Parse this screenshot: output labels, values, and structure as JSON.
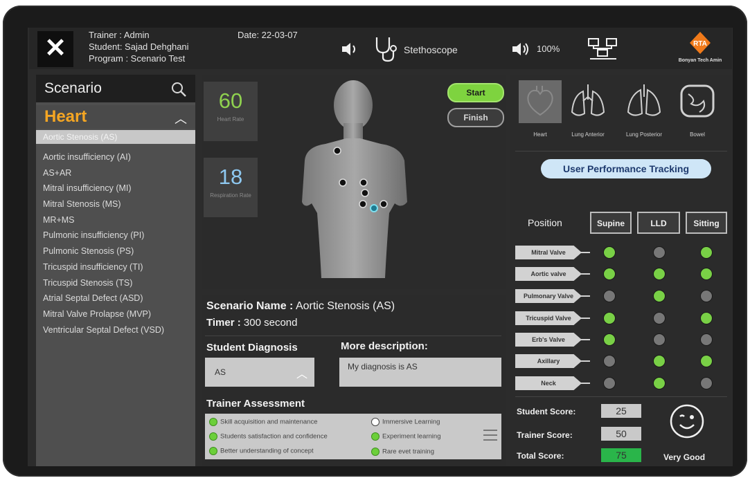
{
  "header": {
    "trainer": "Trainer : Admin",
    "student": "Student: Sajad Dehghani",
    "program": "Program : Scenario Test",
    "date": "Date: 22-03-07",
    "device_label": "Stethoscope",
    "volume": "100%",
    "logo_text": "Bonyan Tech Amin"
  },
  "sidebar": {
    "search_placeholder": "Scenario",
    "category": "Heart",
    "selected_item": "Aortic Stenosis (AS)",
    "items": [
      "Aortic insufficiency (AI)",
      "AS+AR",
      "Mitral insufficiency (MI)",
      "Mitral Stenosis (MS)",
      "MR+MS",
      "Pulmonic insufficiency (PI)",
      "Pulmonic Stenosis (PS)",
      "Tricuspid insufficiency (TI)",
      "Tricuspid Stenosis (TS)",
      "Atrial Septal Defect (ASD)",
      "Mitral Valve Prolapse (MVP)",
      "Ventricular Septal Defect (VSD)"
    ]
  },
  "vitals": {
    "heart_rate": "60",
    "heart_rate_label": "Heart Rate",
    "resp_rate": "18",
    "resp_rate_label": "Respiration Rate",
    "start_label": "Start",
    "finish_label": "Finish"
  },
  "scenario": {
    "name_label": "Scenario Name :",
    "name_value": "Aortic Stenosis (AS)",
    "timer_label": "Timer :",
    "timer_value": "300 second",
    "diagnosis_label": "Student Diagnosis",
    "diagnosis_value": "AS",
    "desc_label": "More description:",
    "desc_value": "My diagnosis is AS",
    "assessment_label": "Trainer Assessment",
    "assessment": [
      {
        "label": "Skill acquisition and maintenance",
        "checked": true
      },
      {
        "label": "Students satisfaction and confidence",
        "checked": true
      },
      {
        "label": "Better understanding of concept",
        "checked": true
      },
      {
        "label": "Immersive Learning",
        "checked": false
      },
      {
        "label": "Experiment learning",
        "checked": true
      },
      {
        "label": "Rare evet training",
        "checked": true
      }
    ]
  },
  "organs": [
    "Heart",
    "Lung Anterior",
    "Lung Posterior",
    "Bowel"
  ],
  "tracking": {
    "button_label": "User Performance Tracking",
    "position_label": "Position",
    "positions": [
      "Supine",
      "LLD",
      "Sitting"
    ],
    "valves": [
      {
        "name": "Mitral Valve",
        "states": [
          "g",
          "gr",
          "g"
        ]
      },
      {
        "name": "Aortic valve",
        "states": [
          "g",
          "g",
          "g"
        ]
      },
      {
        "name": "Pulmonary Valve",
        "states": [
          "gr",
          "g",
          "gr"
        ]
      },
      {
        "name": "Tricuspid Valve",
        "states": [
          "g",
          "gr",
          "g"
        ]
      },
      {
        "name": "Erb's Valve",
        "states": [
          "g",
          "gr",
          "gr"
        ]
      },
      {
        "name": "Axillary",
        "states": [
          "gr",
          "g",
          "g"
        ]
      },
      {
        "name": "Neck",
        "states": [
          "gr",
          "g",
          "gr"
        ]
      }
    ],
    "student_score_label": "Student Score:",
    "student_score": "25",
    "trainer_score_label": "Trainer Score:",
    "trainer_score": "50",
    "total_score_label": "Total  Score:",
    "total_score": "75",
    "rating": "Very Good"
  },
  "colors": {
    "accent_orange": "#f5a623",
    "status_green": "#79d046",
    "status_gray": "#777777",
    "start_green": "#7ed33f"
  }
}
